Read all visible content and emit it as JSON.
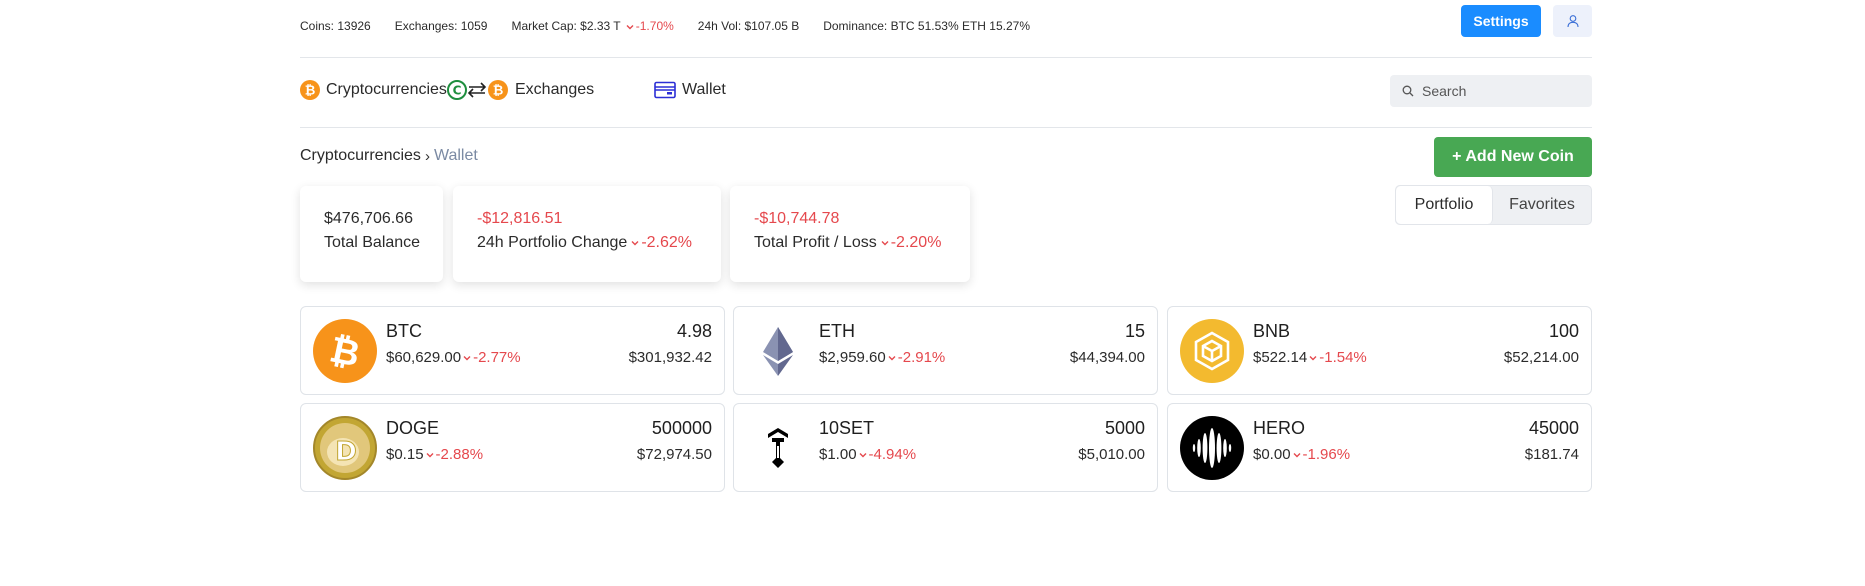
{
  "colors": {
    "settings_bg": "#1a8cff",
    "add_bg": "#48a853",
    "negative": "#e5484d",
    "crumb_muted": "#7b8aa3"
  },
  "stats": {
    "coins": "Coins: 13926",
    "exchanges": "Exchanges: 1059",
    "market_cap_label": "Market Cap: $2.33 T",
    "market_cap_change": "-1.70%",
    "vol": "24h Vol: $107.05 B",
    "dominance": "Dominance: BTC 51.53% ETH 15.27%"
  },
  "header": {
    "settings_label": "Settings",
    "user_icon": "user-icon"
  },
  "nav": {
    "cryptocurrencies": "Cryptocurrencies",
    "exchanges": "Exchanges",
    "wallet": "Wallet",
    "search_placeholder": "Search"
  },
  "breadcrumb": {
    "root": "Cryptocurrencies",
    "current": "Wallet"
  },
  "actions": {
    "add_coin": "+ Add New Coin",
    "tab_portfolio": "Portfolio",
    "tab_favorites": "Favorites"
  },
  "summary": {
    "balance_value": "$476,706.66",
    "balance_label": "Total Balance",
    "change_value": "-$12,816.51",
    "change_label": "24h Portfolio Change",
    "change_pct": "-2.62%",
    "pl_value": "-$10,744.78",
    "pl_label": "Total Profit / Loss",
    "pl_pct": "-2.20%"
  },
  "coins": [
    {
      "symbol": "BTC",
      "price": "$60,629.00",
      "change": "-2.77%",
      "amount": "4.98",
      "value": "$301,932.42",
      "icon": "bitcoin-icon",
      "color": "#f7931a"
    },
    {
      "symbol": "ETH",
      "price": "$2,959.60",
      "change": "-2.91%",
      "amount": "15",
      "value": "$44,394.00",
      "icon": "ethereum-icon",
      "color": "#627eea"
    },
    {
      "symbol": "BNB",
      "price": "$522.14",
      "change": "-1.54%",
      "amount": "100",
      "value": "$52,214.00",
      "icon": "bnb-icon",
      "color": "#f3ba2f"
    },
    {
      "symbol": "DOGE",
      "price": "$0.15",
      "change": "-2.88%",
      "amount": "500000",
      "value": "$72,974.50",
      "icon": "doge-icon",
      "color": "#c2a633"
    },
    {
      "symbol": "10SET",
      "price": "$1.00",
      "change": "-4.94%",
      "amount": "5000",
      "value": "$5,010.00",
      "icon": "tenset-icon",
      "color": "#000000"
    },
    {
      "symbol": "HERO",
      "price": "$0.00",
      "change": "-1.96%",
      "amount": "45000",
      "value": "$181.74",
      "icon": "hero-icon",
      "color": "#000000"
    }
  ]
}
